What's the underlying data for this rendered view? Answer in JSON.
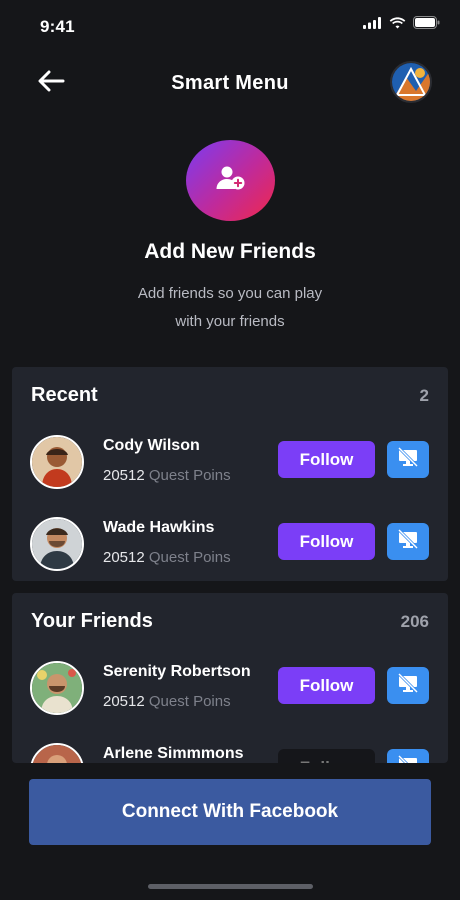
{
  "status": {
    "time": "9:41"
  },
  "nav": {
    "title": "Smart Menu"
  },
  "hero": {
    "title": "Add New Friends",
    "subtitle_line1": "Add friends so you can play",
    "subtitle_line2": "with your friends"
  },
  "recent": {
    "title": "Recent",
    "count": "2",
    "items": [
      {
        "name": "Cody Wilson",
        "points": "20512",
        "points_label": "Quest Poins",
        "follow_label": "Follow"
      },
      {
        "name": "Wade Hawkins",
        "points": "20512",
        "points_label": "Quest Poins",
        "follow_label": "Follow"
      }
    ]
  },
  "friends": {
    "title": "Your Friends",
    "count": "206",
    "items": [
      {
        "name": "Serenity Robertson",
        "points": "20512",
        "points_label": "Quest Poins",
        "follow_label": "Follow"
      },
      {
        "name": "Arlene Simmmons",
        "follow_label": "Follow"
      }
    ]
  },
  "footer": {
    "facebook_label": "Connect With Facebook"
  },
  "colors": {
    "accent_purple": "#7b3ef7",
    "accent_blue": "#3a8ff0",
    "facebook": "#3b5aa0",
    "background": "#151619",
    "card": "#22252d"
  }
}
